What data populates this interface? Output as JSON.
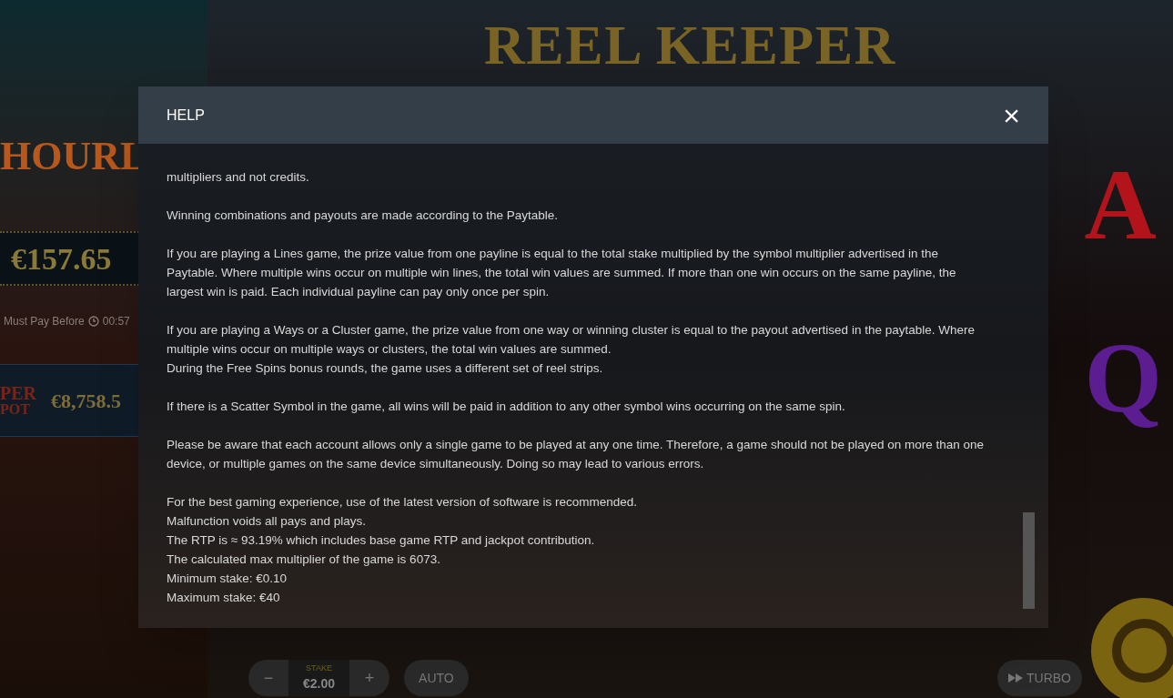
{
  "game": {
    "logo": "REEL KEEPER",
    "side_panel": {
      "hourly_logo": "HOURL",
      "hourly_amount": "€157.65",
      "must_pay_label": "Must Pay Before",
      "timer": "00:57",
      "super_logo_line_1": "PER",
      "super_logo_line_2": "POT",
      "super_amount": "€8,758.5"
    },
    "reel_symbols": [
      {
        "label": "A",
        "color": "#b3141b"
      },
      {
        "label": "Q",
        "color": "#5b1d8f"
      }
    ],
    "controls": {
      "minus": "−",
      "stake_label": "STAKE",
      "stake_value": "€2.00",
      "plus": "+",
      "auto": "AUTO",
      "turbo": "TURBO"
    }
  },
  "dialog": {
    "title": "HELP",
    "close": "×",
    "paragraphs": [
      [
        "multipliers and not credits."
      ],
      [
        "Winning combinations and payouts are made according to the Paytable."
      ],
      [
        "If you are playing a Lines game, the prize value from one payline is equal to the total stake multiplied by the symbol multiplier advertised in the Paytable. Where multiple wins occur on multiple win lines, the total win values are summed. If more than one win occurs on the same payline, the largest win is paid. Each individual payline can pay only once per spin."
      ],
      [
        "If you are playing a Ways or a Cluster game, the prize value from one way or winning cluster is equal to the payout advertised in the paytable. Where multiple wins occur on multiple ways or clusters, the total win values are summed.",
        "During the Free Spins bonus rounds, the game uses a different set of reel strips."
      ],
      [
        "If there is a Scatter Symbol in the game, all wins will be paid in addition to any other symbol wins occurring on the same spin."
      ],
      [
        "Please be aware that each account allows only a single game to be played at any one time. Therefore, a game should not be played on more than one device, or multiple games on the same device simultaneously. Doing so may lead to various errors."
      ],
      [
        "For the best gaming experience, use of the latest version of software is recommended.",
        "Malfunction voids all pays and plays.",
        "The RTP is ≈ 93.19% which includes base game RTP and jackpot contribution.",
        "The calculated max multiplier of the game is 6073.",
        "Minimum stake: €0.10",
        "Maximum stake: €40"
      ]
    ]
  }
}
